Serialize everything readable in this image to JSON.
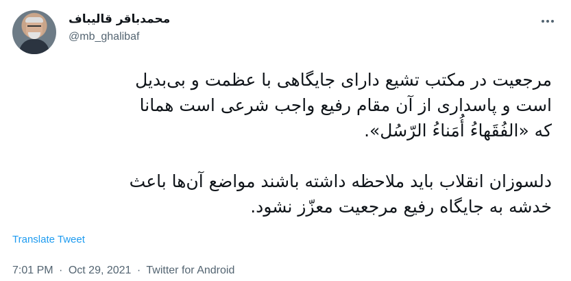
{
  "author": {
    "display_name": "محمدباقر قالیباف",
    "handle": "@mb_ghalibaf",
    "avatar_icon": "profile-photo"
  },
  "tweet": {
    "paragraph1_line1": "مرجعیت در مکتب تشیع دارای جایگاهی با عظمت و بی‌بدیل",
    "paragraph1_line2": "است و پاسداری از آن مقام رفیع واجب شرعی است همانا",
    "paragraph1_line3": "که «الفُقَهاءُ أُمَناءُ الرّسُل».",
    "paragraph2_line1": "دلسوزان انقلاب باید ملاحظه داشته باشند مواضع آن‌ها باعث",
    "paragraph2_line2": "خدشه به جایگاه رفیع مرجعیت معزّز نشود."
  },
  "actions": {
    "translate_label": "Translate Tweet",
    "more_icon": "more-horizontal-icon"
  },
  "meta": {
    "time": "7:01 PM",
    "sep1": "·",
    "date": "Oct 29, 2021",
    "sep2": "·",
    "source": "Twitter for Android"
  },
  "colors": {
    "link": "#1d9bf0",
    "secondary_text": "#536471",
    "primary_text": "#0f1419"
  }
}
